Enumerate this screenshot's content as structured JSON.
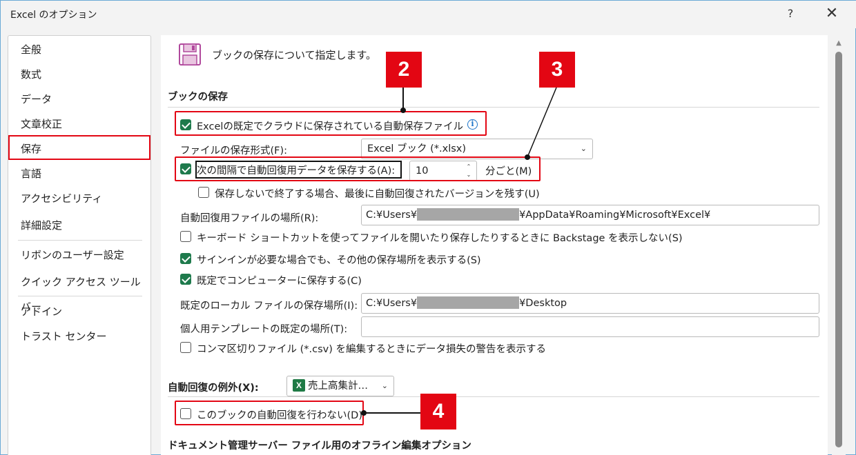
{
  "window": {
    "title": "Excel のオプション",
    "help_label": "?",
    "close_label": "✕"
  },
  "sidebar": {
    "items": [
      {
        "label": "全般"
      },
      {
        "label": "数式"
      },
      {
        "label": "データ"
      },
      {
        "label": "文章校正"
      },
      {
        "label": "保存",
        "selected": true
      },
      {
        "label": "言語"
      },
      {
        "label": "アクセシビリティ"
      },
      {
        "label": "詳細設定"
      },
      {
        "label": "リボンのユーザー設定"
      },
      {
        "label": "クイック アクセス ツール バー"
      },
      {
        "label": "アドイン"
      },
      {
        "label": "トラスト センター"
      }
    ]
  },
  "header": {
    "text": "ブックの保存について指定します。",
    "icon": "save-icon"
  },
  "save_section": {
    "title": "ブックの保存",
    "autosave_cloud": {
      "label": "Excelの既定でクラウドに保存されている自動保存ファイル",
      "checked": true
    },
    "file_format_label": "ファイルの保存形式(F):",
    "file_format_value": "Excel ブック (*.xlsx)",
    "autorecover": {
      "label": "次の間隔で自動回復用データを保存する(A):",
      "checked": true
    },
    "autorecover_minutes": "10",
    "minutes_label": "分ごと(M)",
    "keep_last": {
      "label": "保存しないで終了する場合、最後に自動回復されたバージョンを残す(U)",
      "checked": false
    },
    "autorecover_location_label": "自動回復用ファイルの場所(R):",
    "autorecover_location_prefix": "C:¥Users¥",
    "autorecover_location_suffix": "¥AppData¥Roaming¥Microsoft¥Excel¥",
    "no_backstage": {
      "label": "キーボード ショートカットを使ってファイルを開いたり保存したりするときに Backstage を表示しない(S)",
      "checked": false
    },
    "show_places": {
      "label": "サインインが必要な場合でも、その他の保存場所を表示する(S)",
      "checked": true
    },
    "save_to_computer": {
      "label": "既定でコンピューターに保存する(C)",
      "checked": true
    },
    "local_location_label": "既定のローカル ファイルの保存場所(I):",
    "local_location_prefix": "C:¥Users¥",
    "local_location_suffix": "¥Desktop",
    "template_location_label": "個人用テンプレートの既定の場所(T):",
    "template_location_value": "",
    "csv_warning": {
      "label": "コンマ区切りファイル (*.csv) を編集するときにデータ損失の警告を表示する",
      "checked": false
    }
  },
  "exceptions_section": {
    "title": "自動回復の例外(X):",
    "workbook_value": "売上高集計…",
    "disable_autorecover": {
      "label": "このブックの自動回復を行わない(D)",
      "checked": false
    }
  },
  "offline_section": {
    "title": "ドキュメント管理サーバー ファイル用のオフライン編集オプション"
  },
  "callouts": {
    "c2": "2",
    "c3": "3",
    "c4": "4"
  },
  "colors": {
    "accent_red": "#e30613",
    "checkbox_green": "#1e7a4c",
    "excel_green": "#1f7a45"
  }
}
